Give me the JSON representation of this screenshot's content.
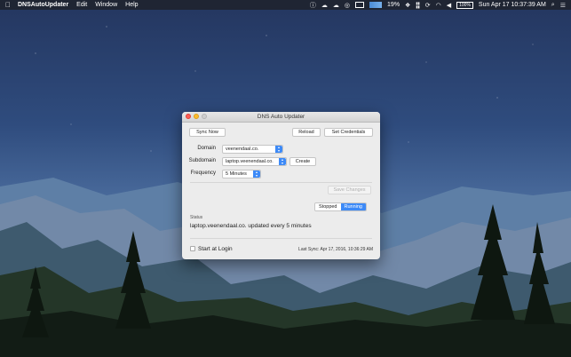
{
  "menubar": {
    "app_name": "DNSAutoUpdater",
    "menus": [
      "Edit",
      "Window",
      "Help"
    ],
    "battery_percent": "19%",
    "battery_label": "100%",
    "datetime": "Sun Apr 17  10:37:39 AM",
    "icons": [
      "apple-icon",
      "info-icon",
      "cloud-icon",
      "cloud-icon",
      "circle-icon",
      "monitor-icon",
      "cpu-graph-icon",
      "dropbox-icon",
      "network-icon",
      "sync-icon",
      "wifi-icon",
      "volume-icon",
      "bluetooth-icon",
      "search-icon",
      "list-icon"
    ]
  },
  "window": {
    "title": "DNS Auto Updater",
    "buttons": {
      "sync_now": "Sync Now",
      "reload": "Reload",
      "set_credentials": "Set Credentials",
      "create": "Create",
      "save_changes": "Save Changes"
    },
    "fields": {
      "domain_label": "Domain",
      "domain_value": "veenendaal.co.",
      "subdomain_label": "Subdomain",
      "subdomain_value": "laptop.veenendaal.co.",
      "frequency_label": "Frequency",
      "frequency_value": "5 Minutes"
    },
    "segmented": {
      "stopped": "Stopped",
      "running": "Running",
      "selected": "Running"
    },
    "status": {
      "heading": "Status",
      "text": "laptop.veenendaal.co. updated every 5 minutes"
    },
    "footer": {
      "start_at_login": "Start at Login",
      "start_at_login_checked": false,
      "last_sync": "Last Sync: Apr 17, 2016, 10:36:29 AM"
    }
  },
  "colors": {
    "accent": "#3d8af7"
  }
}
